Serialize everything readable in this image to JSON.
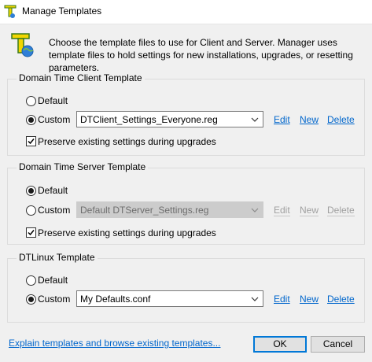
{
  "window": {
    "title": "Manage Templates",
    "intro_text": "Choose the template files to use for Client and Server. Manager uses template files to hold settings for new installations, upgrades, or resetting parameters."
  },
  "groups": {
    "client": {
      "title": "Domain Time Client Template",
      "default_label": "Default",
      "custom_label": "Custom",
      "selected": "custom",
      "custom_value": "DTClient_Settings_Everyone.reg",
      "combo_enabled": true,
      "edit_label": "Edit",
      "new_label": "New",
      "delete_label": "Delete",
      "preserve_label": "Preserve existing settings during upgrades",
      "preserve_checked": true
    },
    "server": {
      "title": "Domain Time Server Template",
      "default_label": "Default",
      "custom_label": "Custom",
      "selected": "default",
      "custom_value": "Default DTServer_Settings.reg",
      "combo_enabled": false,
      "edit_label": "Edit",
      "new_label": "New",
      "delete_label": "Delete",
      "preserve_label": "Preserve existing settings during upgrades",
      "preserve_checked": true
    },
    "dtlinux": {
      "title": "DTLinux Template",
      "default_label": "Default",
      "custom_label": "Custom",
      "selected": "custom",
      "custom_value": "My Defaults.conf",
      "combo_enabled": true,
      "edit_label": "Edit",
      "new_label": "New",
      "delete_label": "Delete"
    }
  },
  "footer": {
    "explain_link": "Explain templates and browse existing templates...",
    "ok_label": "OK",
    "cancel_label": "Cancel"
  },
  "colors": {
    "link": "#0066cc",
    "default_button_border": "#0078d7",
    "window_background": "#f0f0f0"
  },
  "icons": {
    "app": "green-t-globe-icon",
    "header": "green-t-globe-icon",
    "combo_arrow": "chevron-down-icon"
  }
}
